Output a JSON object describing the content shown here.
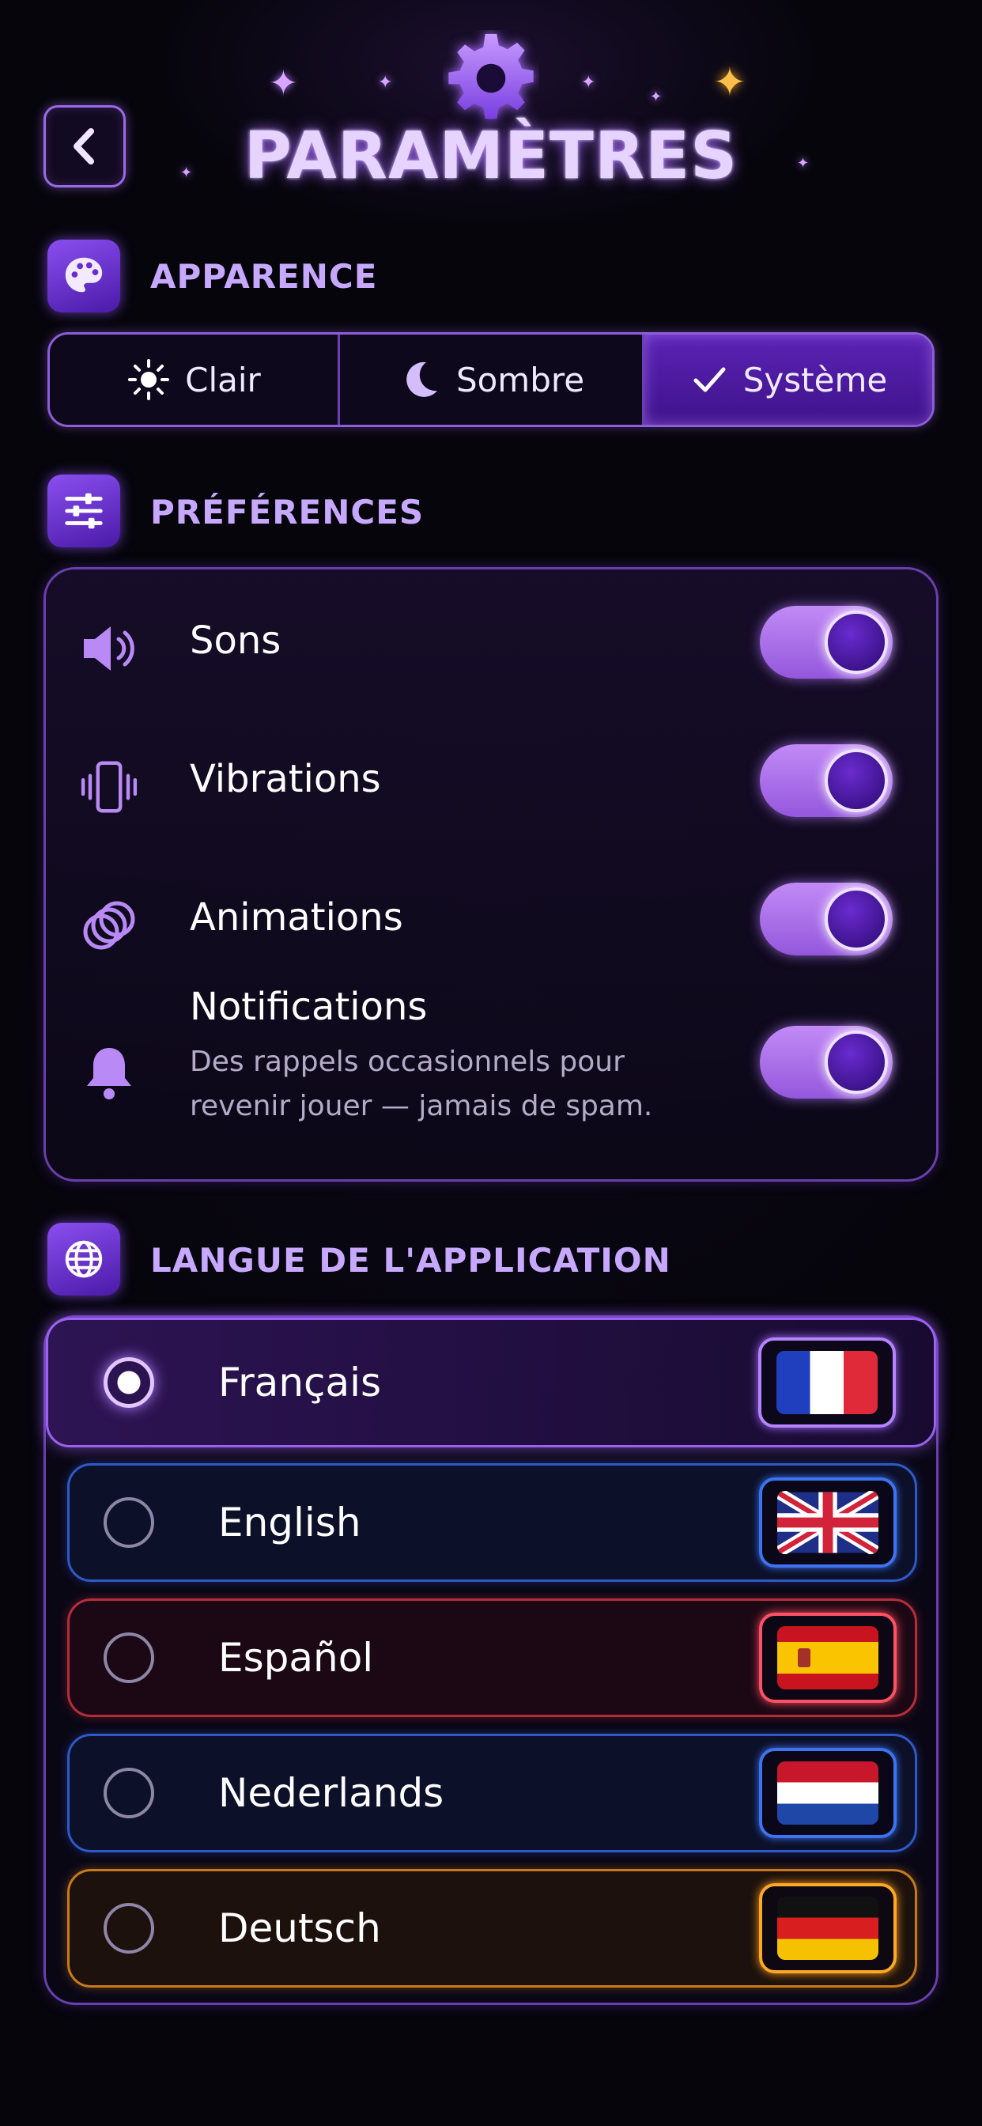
{
  "header": {
    "title": "PARAMÈTRES",
    "back_icon": "chevron-left-icon",
    "top_icon": "gear-icon"
  },
  "appearance": {
    "label": "APPARENCE",
    "icon": "palette-icon",
    "options": [
      {
        "label": "Clair",
        "icon": "sun-icon"
      },
      {
        "label": "Sombre",
        "icon": "moon-icon"
      },
      {
        "label": "Système",
        "icon": "check-icon"
      }
    ],
    "selected": "Système"
  },
  "preferences": {
    "label": "PRÉFÉRENCES",
    "icon": "sliders-icon",
    "items": [
      {
        "label": "Sons",
        "icon": "speaker-icon",
        "on": true
      },
      {
        "label": "Vibrations",
        "icon": "phone-vibrate-icon",
        "on": true
      },
      {
        "label": "Animations",
        "icon": "rings-icon",
        "on": true
      },
      {
        "label": "Notifications",
        "icon": "bell-icon",
        "on": true,
        "sub_1": "Des rappels occasionnels pour",
        "sub_2": "revenir jouer — jamais de spam."
      }
    ]
  },
  "language": {
    "label": "LANGUE DE L'APPLICATION",
    "icon": "globe-icon",
    "items": [
      {
        "label": "Français",
        "flag": "france-flag-icon",
        "selected": true
      },
      {
        "label": "English",
        "flag": "uk-flag-icon",
        "selected": false
      },
      {
        "label": "Español",
        "flag": "spain-flag-icon",
        "selected": false
      },
      {
        "label": "Nederlands",
        "flag": "netherlands-flag-icon",
        "selected": false
      },
      {
        "label": "Deutsch",
        "flag": "germany-flag-icon",
        "selected": false
      }
    ]
  },
  "colors": {
    "accent": "#9b6ae6",
    "background": "#06050c"
  }
}
